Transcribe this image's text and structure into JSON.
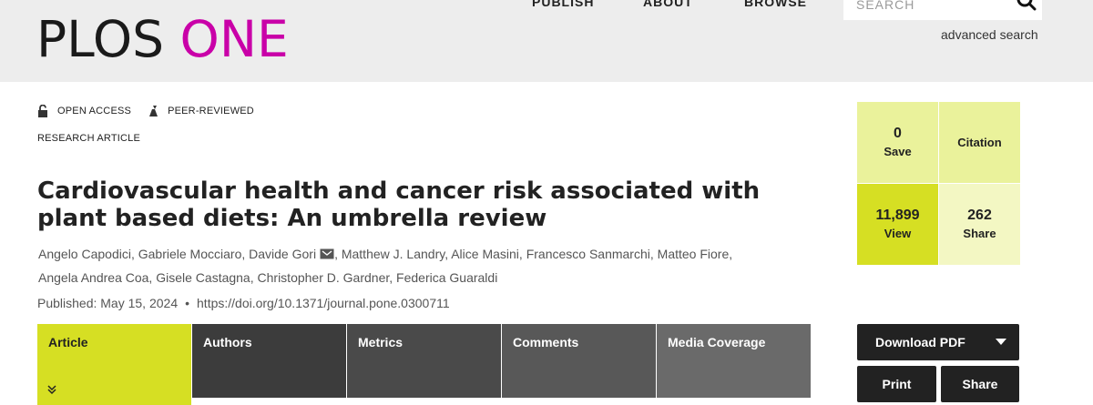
{
  "header": {
    "logo": {
      "plos": "PLOS",
      "one": "ONE"
    },
    "nav": [
      "PUBLISH",
      "ABOUT",
      "BROWSE"
    ],
    "search": {
      "placeholder": "SEARCH",
      "icon": "search-icon"
    },
    "advanced_search": "advanced search"
  },
  "meta": {
    "open_access": "OPEN ACCESS",
    "peer_reviewed": "PEER-REVIEWED",
    "article_type": "RESEARCH ARTICLE"
  },
  "article": {
    "title": "Cardiovascular health and cancer risk associated with plant based diets: An umbrella review",
    "authors": [
      "Angelo Capodici,",
      "Gabriele Mocciaro,",
      "Davide Gori",
      "Matthew J. Landry,",
      "Alice Masini,",
      "Francesco Sanmarchi,",
      "Matteo Fiore,",
      "Angela Andrea Coa,",
      "Gisele Castagna,",
      "Christopher D. Gardner,",
      "Federica Guaraldi"
    ],
    "published": "Published: May 15, 2024",
    "separator": "•",
    "doi": "https://doi.org/10.1371/journal.pone.0300711"
  },
  "tabs": [
    "Article",
    "Authors",
    "Metrics",
    "Comments",
    "Media Coverage"
  ],
  "metrics": {
    "save": {
      "value": "0",
      "label": "Save"
    },
    "citation": {
      "label": "Citation"
    },
    "view": {
      "value": "11,899",
      "label": "View"
    },
    "share": {
      "value": "262",
      "label": "Share"
    }
  },
  "actions": {
    "download_pdf": "Download PDF",
    "print": "Print",
    "share": "Share"
  },
  "colors": {
    "brand_magenta": "#c900a8",
    "accent_lime": "#d6df23",
    "light_lime": "#eaf29b",
    "header_bg": "#ededed"
  }
}
